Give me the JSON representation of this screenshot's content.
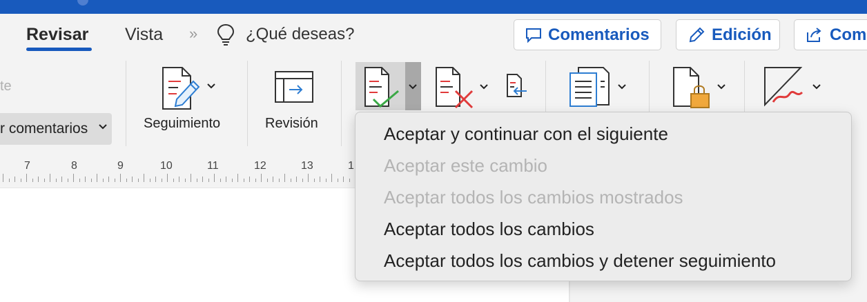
{
  "tabs": [
    {
      "label": "Revisar",
      "active": true
    },
    {
      "label": "Vista",
      "active": false
    }
  ],
  "tell_me": {
    "text": "¿Qué deseas?"
  },
  "header_buttons": {
    "comments": "Comentarios",
    "editing": "Edición",
    "share": "Com"
  },
  "ribbon": {
    "partial_label": "te",
    "comments_combo": "r comentarios",
    "tracking": "Seguimiento",
    "review": "Revisión"
  },
  "ruler": {
    "numbers": [
      "7",
      "8",
      "9",
      "10",
      "11",
      "12",
      "13",
      "1"
    ]
  },
  "accept_menu": {
    "items": [
      {
        "label": "Aceptar y continuar con el siguiente",
        "enabled": true
      },
      {
        "label": "Aceptar este cambio",
        "enabled": false
      },
      {
        "label": "Aceptar todos los cambios mostrados",
        "enabled": false
      },
      {
        "label": "Aceptar todos los cambios",
        "enabled": true
      },
      {
        "label": "Aceptar todos los cambios y detener seguimiento",
        "enabled": true
      }
    ]
  },
  "colors": {
    "accent": "#185abd",
    "disabled_text": "#b4b4b4",
    "accept_green": "#3aa845",
    "reject_red": "#e03b3b",
    "lock_orange": "#f0a83c"
  },
  "icons": [
    "speech-bubble-icon",
    "pencil-icon",
    "share-icon",
    "lightbulb-icon",
    "track-changes-icon",
    "review-pane-icon",
    "accept-icon",
    "reject-icon",
    "previous-change-icon",
    "compare-icon",
    "protect-icon",
    "ink-icon"
  ]
}
